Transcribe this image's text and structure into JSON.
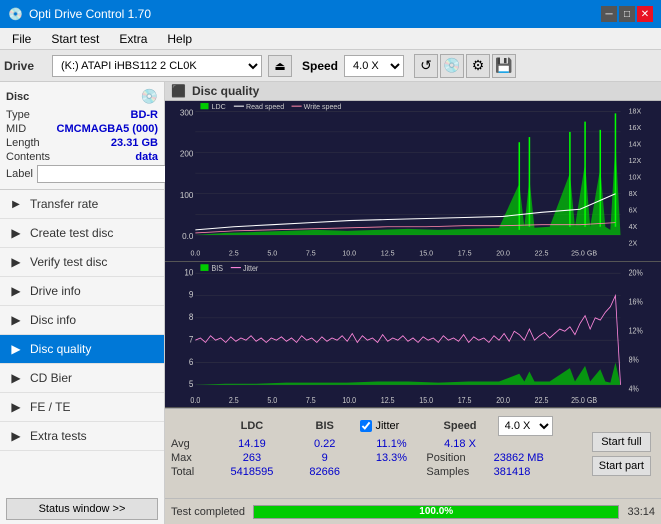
{
  "titlebar": {
    "title": "Opti Drive Control 1.70",
    "minimize": "─",
    "maximize": "□",
    "close": "✕"
  },
  "menubar": {
    "items": [
      "File",
      "Start test",
      "Extra",
      "Help"
    ]
  },
  "drivebar": {
    "label": "Drive",
    "drive_value": "(K:)  ATAPI iHBS112  2 CL0K",
    "speed_label": "Speed",
    "speed_value": "4.0 X"
  },
  "disc": {
    "title": "Disc",
    "type_label": "Type",
    "type_value": "BD-R",
    "mid_label": "MID",
    "mid_value": "CMCMAGBA5 (000)",
    "length_label": "Length",
    "length_value": "23.31 GB",
    "contents_label": "Contents",
    "contents_value": "data",
    "label_label": "Label",
    "label_value": ""
  },
  "nav": {
    "items": [
      {
        "id": "transfer-rate",
        "label": "Transfer rate",
        "icon": "→"
      },
      {
        "id": "create-test-disc",
        "label": "Create test disc",
        "icon": "⊕"
      },
      {
        "id": "verify-test-disc",
        "label": "Verify test disc",
        "icon": "✓"
      },
      {
        "id": "drive-info",
        "label": "Drive info",
        "icon": "ℹ"
      },
      {
        "id": "disc-info",
        "label": "Disc info",
        "icon": "◎"
      },
      {
        "id": "disc-quality",
        "label": "Disc quality",
        "icon": "★",
        "active": true
      },
      {
        "id": "cd-bier",
        "label": "CD Bier",
        "icon": "♦"
      },
      {
        "id": "fe-te",
        "label": "FE / TE",
        "icon": "≈"
      },
      {
        "id": "extra-tests",
        "label": "Extra tests",
        "icon": "⊞"
      }
    ],
    "status_btn": "Status window >>"
  },
  "quality": {
    "title": "Disc quality",
    "legend": {
      "ldc": "LDC",
      "read_speed": "Read speed",
      "write_speed": "Write speed",
      "bis": "BIS",
      "jitter": "Jitter"
    }
  },
  "stats": {
    "headers": [
      "LDC",
      "BIS",
      "",
      "Jitter",
      "Speed",
      ""
    ],
    "avg_label": "Avg",
    "avg_ldc": "14.19",
    "avg_bis": "0.22",
    "avg_jitter": "11.1%",
    "avg_speed": "4.18 X",
    "speed_select": "4.0 X",
    "max_label": "Max",
    "max_ldc": "263",
    "max_bis": "9",
    "max_jitter": "13.3%",
    "position_label": "Position",
    "position_val": "23862 MB",
    "total_label": "Total",
    "total_ldc": "5418595",
    "total_bis": "82666",
    "samples_label": "Samples",
    "samples_val": "381418",
    "jitter_checked": true,
    "jitter_label": "Jitter",
    "start_full": "Start full",
    "start_part": "Start part"
  },
  "bottom": {
    "status": "Test completed",
    "progress": "100.0%",
    "time": "33:14"
  },
  "chart1": {
    "y_max": 300,
    "y_axis_right": [
      "18X",
      "16X",
      "14X",
      "12X",
      "10X",
      "8X",
      "6X",
      "4X",
      "2X"
    ],
    "x_axis": [
      "0.0",
      "2.5",
      "5.0",
      "7.5",
      "10.0",
      "12.5",
      "15.0",
      "17.5",
      "20.0",
      "22.5",
      "25.0 GB"
    ]
  },
  "chart2": {
    "y_max": 10,
    "y_axis_right": [
      "20%",
      "16%",
      "12%",
      "8%",
      "4%"
    ],
    "x_axis": [
      "0.0",
      "2.5",
      "5.0",
      "7.5",
      "10.0",
      "12.5",
      "15.0",
      "17.5",
      "20.0",
      "22.5",
      "25.0 GB"
    ]
  }
}
